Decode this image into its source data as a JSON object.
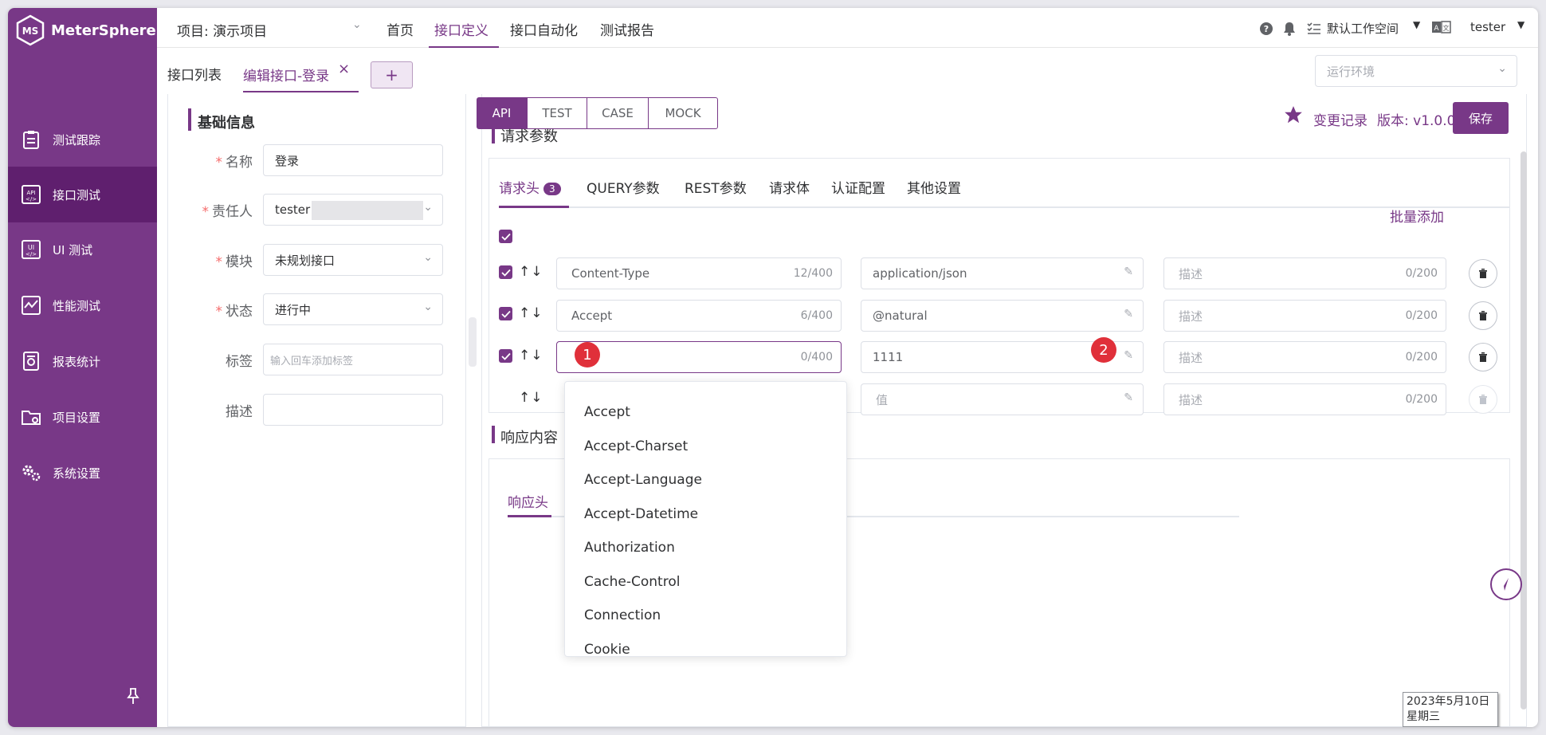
{
  "app": {
    "name": "MeterSphere"
  },
  "sidebar": {
    "items": [
      {
        "label": "测试跟踪",
        "icon": "clipboard-icon"
      },
      {
        "label": "接口测试",
        "icon": "api-icon",
        "active": true
      },
      {
        "label": "UI 测试",
        "icon": "ui-icon"
      },
      {
        "label": "性能测试",
        "icon": "performance-icon"
      },
      {
        "label": "报表统计",
        "icon": "report-icon"
      },
      {
        "label": "项目设置",
        "icon": "folder-settings-icon"
      },
      {
        "label": "系统设置",
        "icon": "gear-icon"
      }
    ]
  },
  "header": {
    "project_label": "项目: 演示项目",
    "nav": [
      "首页",
      "接口定义",
      "接口自动化",
      "测试报告"
    ],
    "active_nav": "接口定义",
    "workspace": "默认工作空间",
    "user": "tester"
  },
  "tabs": {
    "items": [
      "接口列表",
      "编辑接口-登录"
    ],
    "add": "+",
    "env_placeholder": "运行环境"
  },
  "basic": {
    "title": "基础信息",
    "name_label": "名称",
    "name_value": "登录",
    "owner_label": "责任人",
    "owner_value": "tester",
    "module_label": "模块",
    "module_value": "未规划接口",
    "status_label": "状态",
    "status_value": "进行中",
    "tag_label": "标签",
    "tag_placeholder": "输入回车添加标签",
    "desc_label": "描述"
  },
  "modes": [
    "API",
    "TEST",
    "CASE",
    "MOCK"
  ],
  "toolbar": {
    "change_log": "变更记录",
    "version": "版本: v1.0.0",
    "save": "保存"
  },
  "request": {
    "title": "请求参数",
    "subtabs": [
      "请求头",
      "QUERY参数",
      "REST参数",
      "请求体",
      "认证配置",
      "其他设置"
    ],
    "header_count": "3",
    "batch_add": "批量添加",
    "rows": [
      {
        "name": "Content-Type",
        "name_count": "12/400",
        "value": "application/json",
        "desc_ph": "描述",
        "desc_count": "0/200"
      },
      {
        "name": "Accept",
        "name_count": "6/400",
        "value": "@natural",
        "desc_ph": "描述",
        "desc_count": "0/200"
      },
      {
        "name": "",
        "name_count": "0/400",
        "value": "1111",
        "desc_ph": "描述",
        "desc_count": "0/200"
      },
      {
        "name": "",
        "name_count": "",
        "value_ph": "值",
        "desc_ph": "描述",
        "desc_count": "0/200"
      }
    ]
  },
  "dropdown": [
    "Accept",
    "Accept-Charset",
    "Accept-Language",
    "Accept-Datetime",
    "Authorization",
    "Cache-Control",
    "Connection",
    "Cookie"
  ],
  "response": {
    "title": "响应内容",
    "tab": "响应头"
  },
  "markers": [
    "1",
    "2"
  ],
  "clock": {
    "date": "2023年5月10日",
    "weekday": "星期三"
  }
}
